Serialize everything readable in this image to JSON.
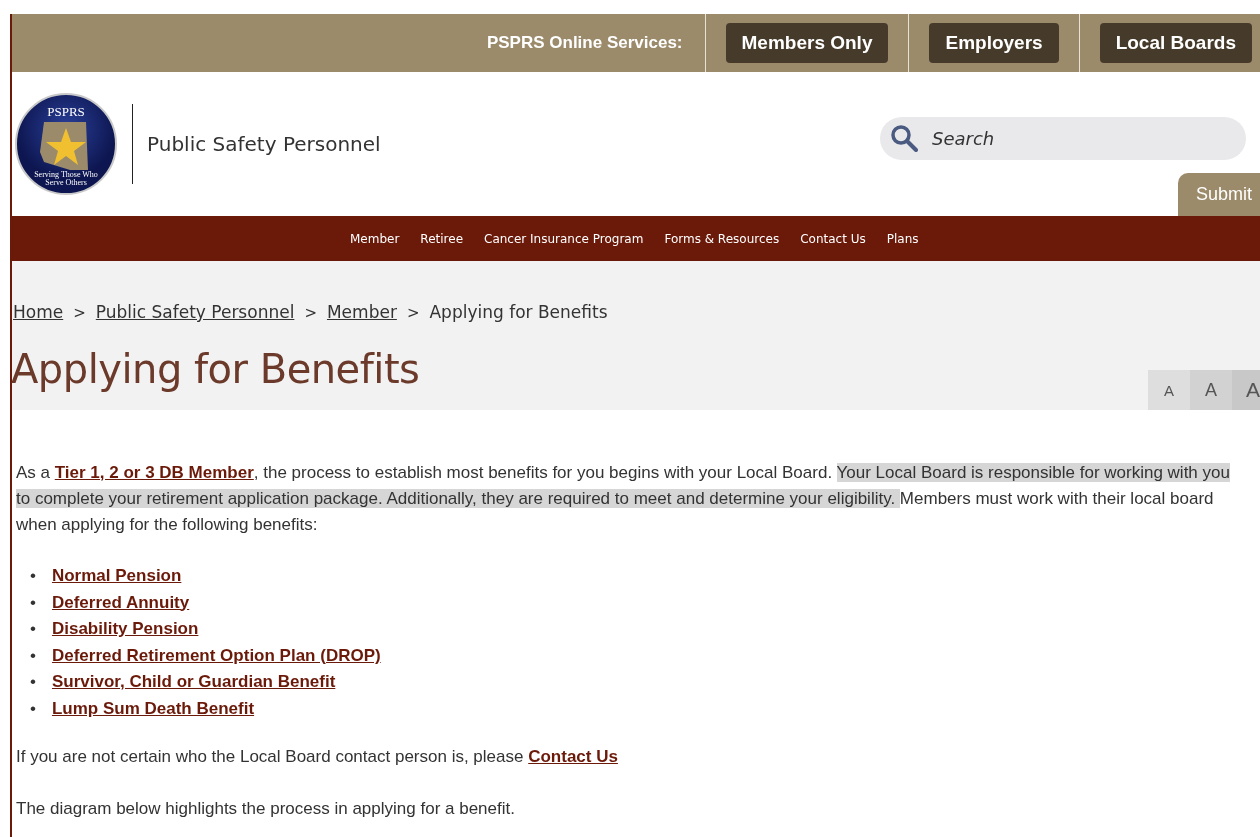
{
  "top_bar": {
    "label": "PSPRS Online Services:",
    "buttons": [
      "Members Only",
      "Employers",
      "Local Boards"
    ]
  },
  "header": {
    "logo": {
      "abbr": "PSPRS",
      "motto": [
        "Serving Those Who",
        "Serve Others"
      ]
    },
    "site_name": "Public Safety Personnel",
    "search": {
      "placeholder": "Search"
    },
    "submit": "Submit"
  },
  "nav": [
    "Member",
    "Retiree",
    "Cancer Insurance Program",
    "Forms & Resources",
    "Contact Us",
    "Plans"
  ],
  "breadcrumb": {
    "separator": ">",
    "items": [
      {
        "label": "Home",
        "kind": "link"
      },
      {
        "label": "Public Safety Personnel",
        "kind": "link"
      },
      {
        "label": "Member",
        "kind": "link"
      },
      {
        "label": "Applying for Benefits",
        "kind": "current"
      }
    ]
  },
  "title": "Applying for Benefits",
  "font_size_buttons": [
    "A",
    "A",
    "A"
  ],
  "intro": [
    {
      "kind": "text",
      "text": "As a "
    },
    {
      "kind": "link",
      "text": "Tier 1, 2 or 3 DB Member"
    },
    {
      "kind": "text",
      "text": ", the process to establish most benefits for you begins with your Local Board. "
    },
    {
      "kind": "highlight",
      "text": "Your Local Board is responsible for working with you to complete your retirement application package.   Additionally, they are required to meet and determine your eligibility. "
    },
    {
      "kind": "text",
      "text": " Members must work with their local board when applying for the following benefits:"
    }
  ],
  "bullet": "•",
  "benefits": [
    "Normal Pension",
    "Deferred Annuity",
    "Disability Pension",
    "Deferred Retirement Option Plan (DROP)",
    "Survivor, Child or Guardian Benefit",
    "Lump Sum Death Benefit"
  ],
  "contact_line": {
    "text": "If you are not certain who the Local Board contact person is, please ",
    "link": "Contact Us"
  },
  "diagram_note": "The diagram below highlights the process in applying for a benefit."
}
